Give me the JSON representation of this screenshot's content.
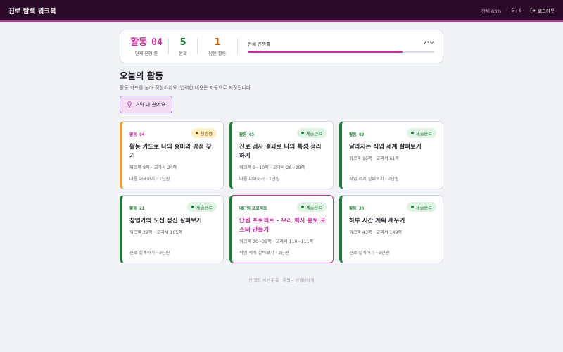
{
  "app": {
    "title": "진로 탐색 워크북",
    "overall_text": "전체 83%",
    "separator": "·",
    "count_text": "5 / 6",
    "logout_label": "로그아웃"
  },
  "summary": {
    "current_label_a": "활동",
    "current_label_b": "04",
    "current_caption": "현재 진행 중",
    "done_value": "5",
    "done_caption": "완료",
    "left_value": "1",
    "left_caption": "남은 활동",
    "progress_label": "전체 진행률",
    "progress_value_text": "83%",
    "progress_fraction": 0.83
  },
  "main": {
    "heading": "오늘의 활동",
    "subtext": "활동 카드를 눌러 작성하세요. 입력한 내용은 자동으로 저장됩니다.",
    "almost_label": "거의 다 왔어요"
  },
  "cards": [
    {
      "tag": "활동 04",
      "badge": "진행중",
      "title": "활동 카드로 나의 흥미와 강점 찾기",
      "meta": "워크북 8쪽 · 교과서 24쪽",
      "unit": "나를 이해하기 · 1단원"
    },
    {
      "tag": "활동 05",
      "badge": "제출완료",
      "title": "진로 검사 결과로 나의 특성 정리하기",
      "meta": "워크북 9~10쪽 · 교과서 28~29쪽",
      "unit": "나를 이해하기 · 1단원"
    },
    {
      "tag": "활동 09",
      "badge": "제출완료",
      "title": "달라지는 직업 세계 살펴보기",
      "meta": "워크북 16쪽 · 교과서 61쪽",
      "unit": "직업 세계 살펴보기 · 2단원"
    },
    {
      "tag": "활동 21",
      "badge": "제출완료",
      "title": "창업가의 도전 정신 살펴보기",
      "meta": "워크북 29쪽 · 교과서 105쪽",
      "unit": "진로 설계하기 · 3단원"
    },
    {
      "tag": "대단원 프로젝트",
      "badge": "제출완료",
      "title": "단원 프로젝트 - 우리 회사 홍보 포스터 만들기",
      "meta": "워크북 30~31쪽 · 교과서 110~111쪽",
      "unit": "직업 세계 살펴보기 · 2단원"
    },
    {
      "tag": "활동 30",
      "badge": "제출완료",
      "title": "하루 시간 계획 세우기",
      "meta": "워크북 43쪽 · 교과서 149쪽",
      "unit": "진로 설계하기 · 3단원"
    }
  ],
  "footer": {
    "text": "반 코드 세션 유효 · 문의는 선생님에게"
  },
  "colors": {
    "accent": "#c0339a",
    "done": "#1f7a3a",
    "in_progress": "#e8a23a",
    "topbar": "#2a0a28"
  }
}
